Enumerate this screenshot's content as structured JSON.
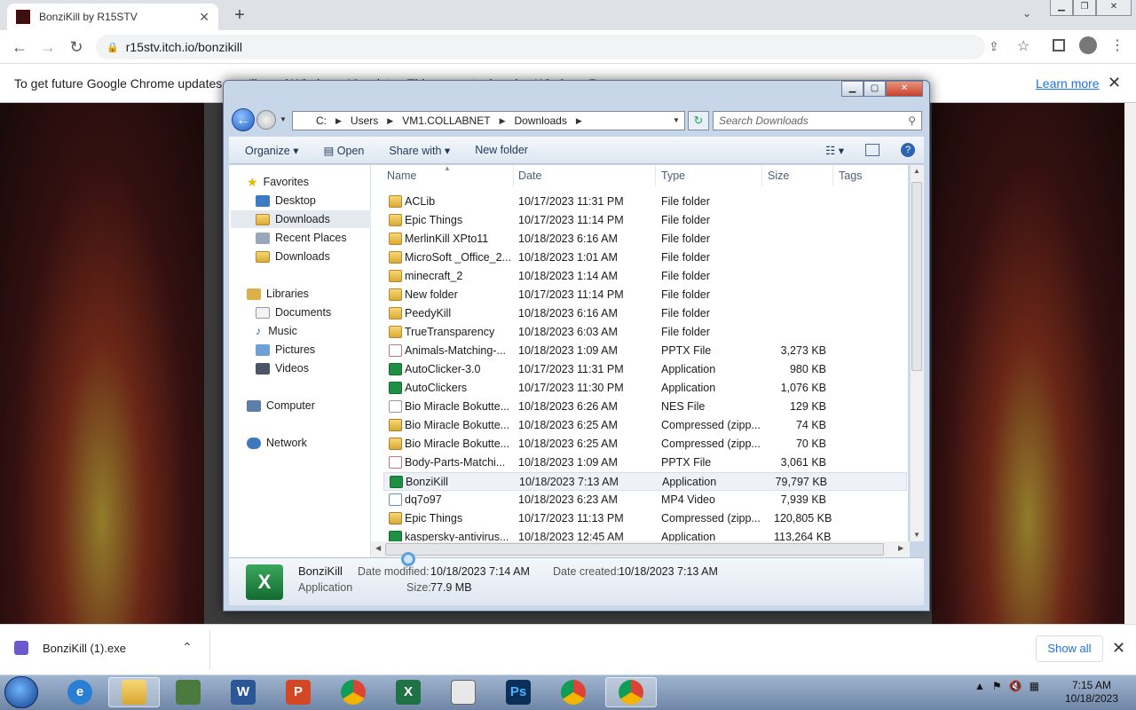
{
  "browser": {
    "tab_title": "BonziKill by R15STV",
    "url": "r15stv.itch.io/bonzikill"
  },
  "infobar": {
    "text": "To get future Google Chrome updates, you'll need Windows 10 or later. This computer is using Windows 7.",
    "learn_more": "Learn more"
  },
  "explorer": {
    "address": [
      "C:",
      "Users",
      "VM1.COLLABNET",
      "Downloads"
    ],
    "search_placeholder": "Search Downloads",
    "commands": {
      "organize": "Organize",
      "open": "Open",
      "share_with": "Share with",
      "new_folder": "New folder"
    },
    "nav": {
      "favorites": "Favorites",
      "desktop": "Desktop",
      "downloads": "Downloads",
      "recent_places": "Recent Places",
      "downloads2": "Downloads",
      "libraries": "Libraries",
      "documents": "Documents",
      "music": "Music",
      "pictures": "Pictures",
      "videos": "Videos",
      "computer": "Computer",
      "network": "Network"
    },
    "columns": {
      "name": "Name",
      "date": "Date",
      "type": "Type",
      "size": "Size",
      "tags": "Tags"
    },
    "files": [
      {
        "name": "ACLib",
        "date": "10/17/2023 11:31 PM",
        "type": "File folder",
        "size": "",
        "kind": "folder"
      },
      {
        "name": "Epic Things",
        "date": "10/17/2023 11:14 PM",
        "type": "File folder",
        "size": "",
        "kind": "folder"
      },
      {
        "name": "MerlinKill XPto11",
        "date": "10/18/2023 6:16 AM",
        "type": "File folder",
        "size": "",
        "kind": "folder"
      },
      {
        "name": "MicroSoft _Office_2...",
        "date": "10/18/2023 1:01 AM",
        "type": "File folder",
        "size": "",
        "kind": "folder"
      },
      {
        "name": "minecraft_2",
        "date": "10/18/2023 1:14 AM",
        "type": "File folder",
        "size": "",
        "kind": "folder"
      },
      {
        "name": "New folder",
        "date": "10/17/2023 11:14 PM",
        "type": "File folder",
        "size": "",
        "kind": "folder"
      },
      {
        "name": "PeedyKill",
        "date": "10/18/2023 6:16 AM",
        "type": "File folder",
        "size": "",
        "kind": "folder"
      },
      {
        "name": "TrueTransparency",
        "date": "10/18/2023 6:03 AM",
        "type": "File folder",
        "size": "",
        "kind": "folder"
      },
      {
        "name": "Animals-Matching-...",
        "date": "10/18/2023 1:09 AM",
        "type": "PPTX File",
        "size": "3,273 KB",
        "kind": "pptx"
      },
      {
        "name": "AutoClicker-3.0",
        "date": "10/17/2023 11:31 PM",
        "type": "Application",
        "size": "980 KB",
        "kind": "app"
      },
      {
        "name": "AutoClickers",
        "date": "10/17/2023 11:30 PM",
        "type": "Application",
        "size": "1,076 KB",
        "kind": "app"
      },
      {
        "name": "Bio Miracle Bokutte...",
        "date": "10/18/2023 6:26 AM",
        "type": "NES File",
        "size": "129 KB",
        "kind": "nes"
      },
      {
        "name": "Bio Miracle Bokutte...",
        "date": "10/18/2023 6:25 AM",
        "type": "Compressed (zipp...",
        "size": "74 KB",
        "kind": "zip"
      },
      {
        "name": "Bio Miracle Bokutte...",
        "date": "10/18/2023 6:25 AM",
        "type": "Compressed (zipp...",
        "size": "70 KB",
        "kind": "zip"
      },
      {
        "name": "Body-Parts-Matchi...",
        "date": "10/18/2023 1:09 AM",
        "type": "PPTX File",
        "size": "3,061 KB",
        "kind": "pptx"
      },
      {
        "name": "BonziKill",
        "date": "10/18/2023 7:13 AM",
        "type": "Application",
        "size": "79,797 KB",
        "kind": "app",
        "selected": true
      },
      {
        "name": "dq7o97",
        "date": "10/18/2023 6:23 AM",
        "type": "MP4 Video",
        "size": "7,939 KB",
        "kind": "mp4"
      },
      {
        "name": "Epic Things",
        "date": "10/17/2023 11:13 PM",
        "type": "Compressed (zipp...",
        "size": "120,805 KB",
        "kind": "zip"
      },
      {
        "name": "kaspersky-antivirus...",
        "date": "10/18/2023 12:45 AM",
        "type": "Application",
        "size": "113,264 KB",
        "kind": "app"
      }
    ],
    "details": {
      "name": "BonziKill",
      "kind": "Application",
      "date_modified_label": "Date modified:",
      "date_modified": "10/18/2023 7:14 AM",
      "date_created_label": "Date created:",
      "date_created": "10/18/2023 7:13 AM",
      "size_label": "Size:",
      "size": "77.9 MB"
    }
  },
  "downloads": {
    "item": "BonziKill (1).exe",
    "show_all": "Show all"
  },
  "taskbar": {
    "time": "7:15 AM",
    "date": "10/18/2023"
  }
}
